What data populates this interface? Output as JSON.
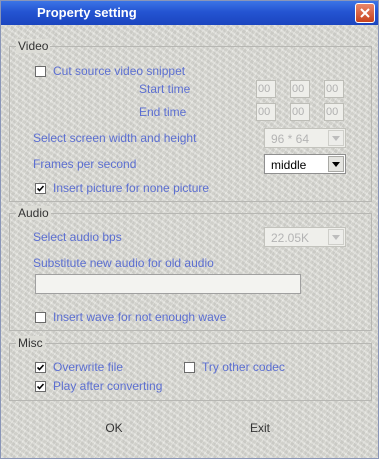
{
  "window": {
    "title": "Property setting"
  },
  "video": {
    "legend": "Video",
    "cut_snippet": {
      "label": "Cut source video snippet",
      "checked": false
    },
    "start_time": {
      "label": "Start time",
      "fields": [
        "00",
        "00",
        "00"
      ]
    },
    "end_time": {
      "label": "End time",
      "fields": [
        "00",
        "00",
        "00"
      ]
    },
    "screen_size": {
      "label": "Select screen width and height",
      "value": "96 * 64"
    },
    "fps": {
      "label": "Frames per second",
      "value": "middle"
    },
    "insert_picture": {
      "label": "Insert picture for none picture",
      "checked": true
    }
  },
  "audio": {
    "legend": "Audio",
    "bps": {
      "label": "Select audio bps",
      "value": "22.05K"
    },
    "substitute": {
      "label": "Substitute new audio for old audio",
      "value": ""
    },
    "insert_wave": {
      "label": "Insert wave for not enough wave",
      "checked": false
    }
  },
  "misc": {
    "legend": "Misc",
    "overwrite": {
      "label": "Overwrite file",
      "checked": true
    },
    "other_codec": {
      "label": "Try other codec",
      "checked": false
    },
    "play_after": {
      "label": "Play after converting",
      "checked": true
    }
  },
  "buttons": {
    "ok": "OK",
    "exit": "Exit"
  },
  "colors": {
    "title_bar": "#2454d2",
    "label_text": "#5c6fd1",
    "close_button": "#c8421d"
  }
}
